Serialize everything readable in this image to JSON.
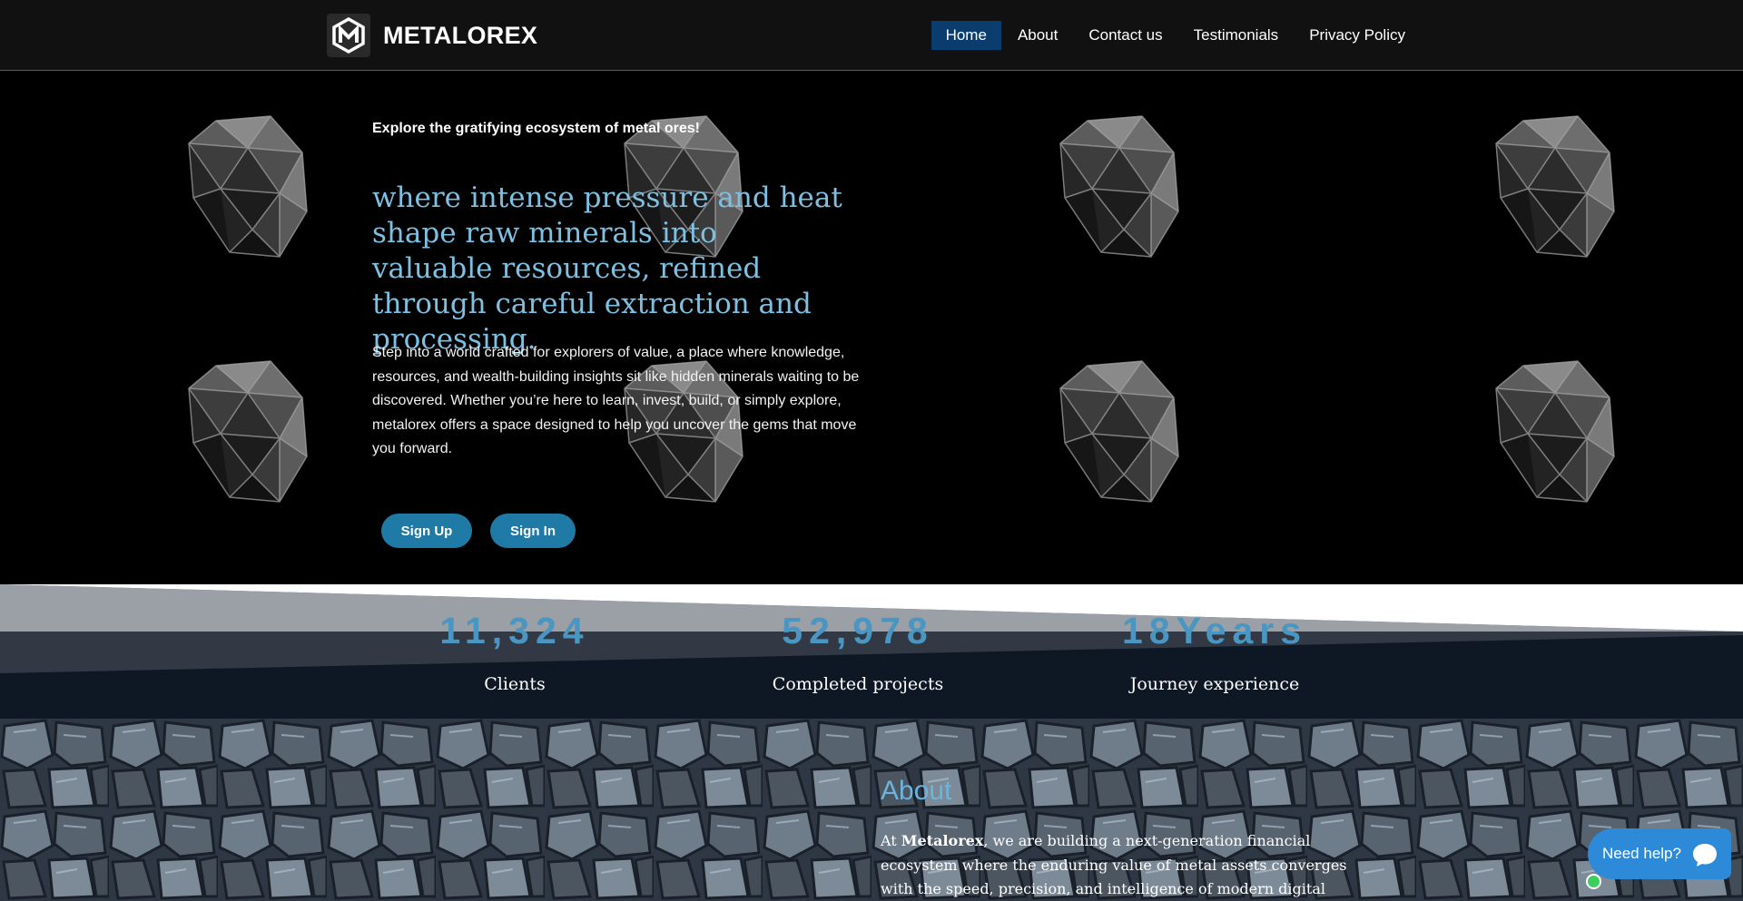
{
  "brand": {
    "name": "METALOREX",
    "logo_icon": "m-hexagon-logo-icon"
  },
  "nav": {
    "items": [
      {
        "label": "Home",
        "active": true
      },
      {
        "label": "About",
        "active": false
      },
      {
        "label": "Contact us",
        "active": false
      },
      {
        "label": "Testimonials",
        "active": false
      },
      {
        "label": "Privacy Policy",
        "active": false
      }
    ]
  },
  "hero": {
    "eyebrow": "Explore the gratifying ecosystem of metal ores!",
    "headline": "where intense pressure and heat shape raw minerals into valuable resources, refined through careful extraction and processing.",
    "intro": "Step into a world crafted for explorers of value, a place where knowledge, resources, and wealth-building insights sit like hidden minerals waiting to be discovered. Whether you’re here to learn, invest, build, or simply explore, metalorex offers a space designed to help you uncover the gems that move you forward.",
    "signup_label": "Sign Up",
    "signin_label": "Sign In"
  },
  "stats": [
    {
      "value": "11,324",
      "label": "Clients"
    },
    {
      "value": "52,978",
      "label": "Completed projects"
    },
    {
      "value": "18Years",
      "label": "Journey experience"
    }
  ],
  "about": {
    "title": "About",
    "text_prefix": "At ",
    "text_brand": "Metalorex",
    "text_rest": ", we are building a next-generation financial ecosystem where the enduring value of metal assets converges with the speed, precision, and intelligence of modern digital finance. Our platform"
  },
  "chat": {
    "label": "Need help?",
    "icon": "chat-bubble-icon"
  },
  "colors": {
    "accent": "#7ec0e2",
    "stat_number": "#4a96c2",
    "nav_active": "#0b3c6e",
    "button": "#1f7aa6",
    "chat": "#2c8ad8"
  }
}
